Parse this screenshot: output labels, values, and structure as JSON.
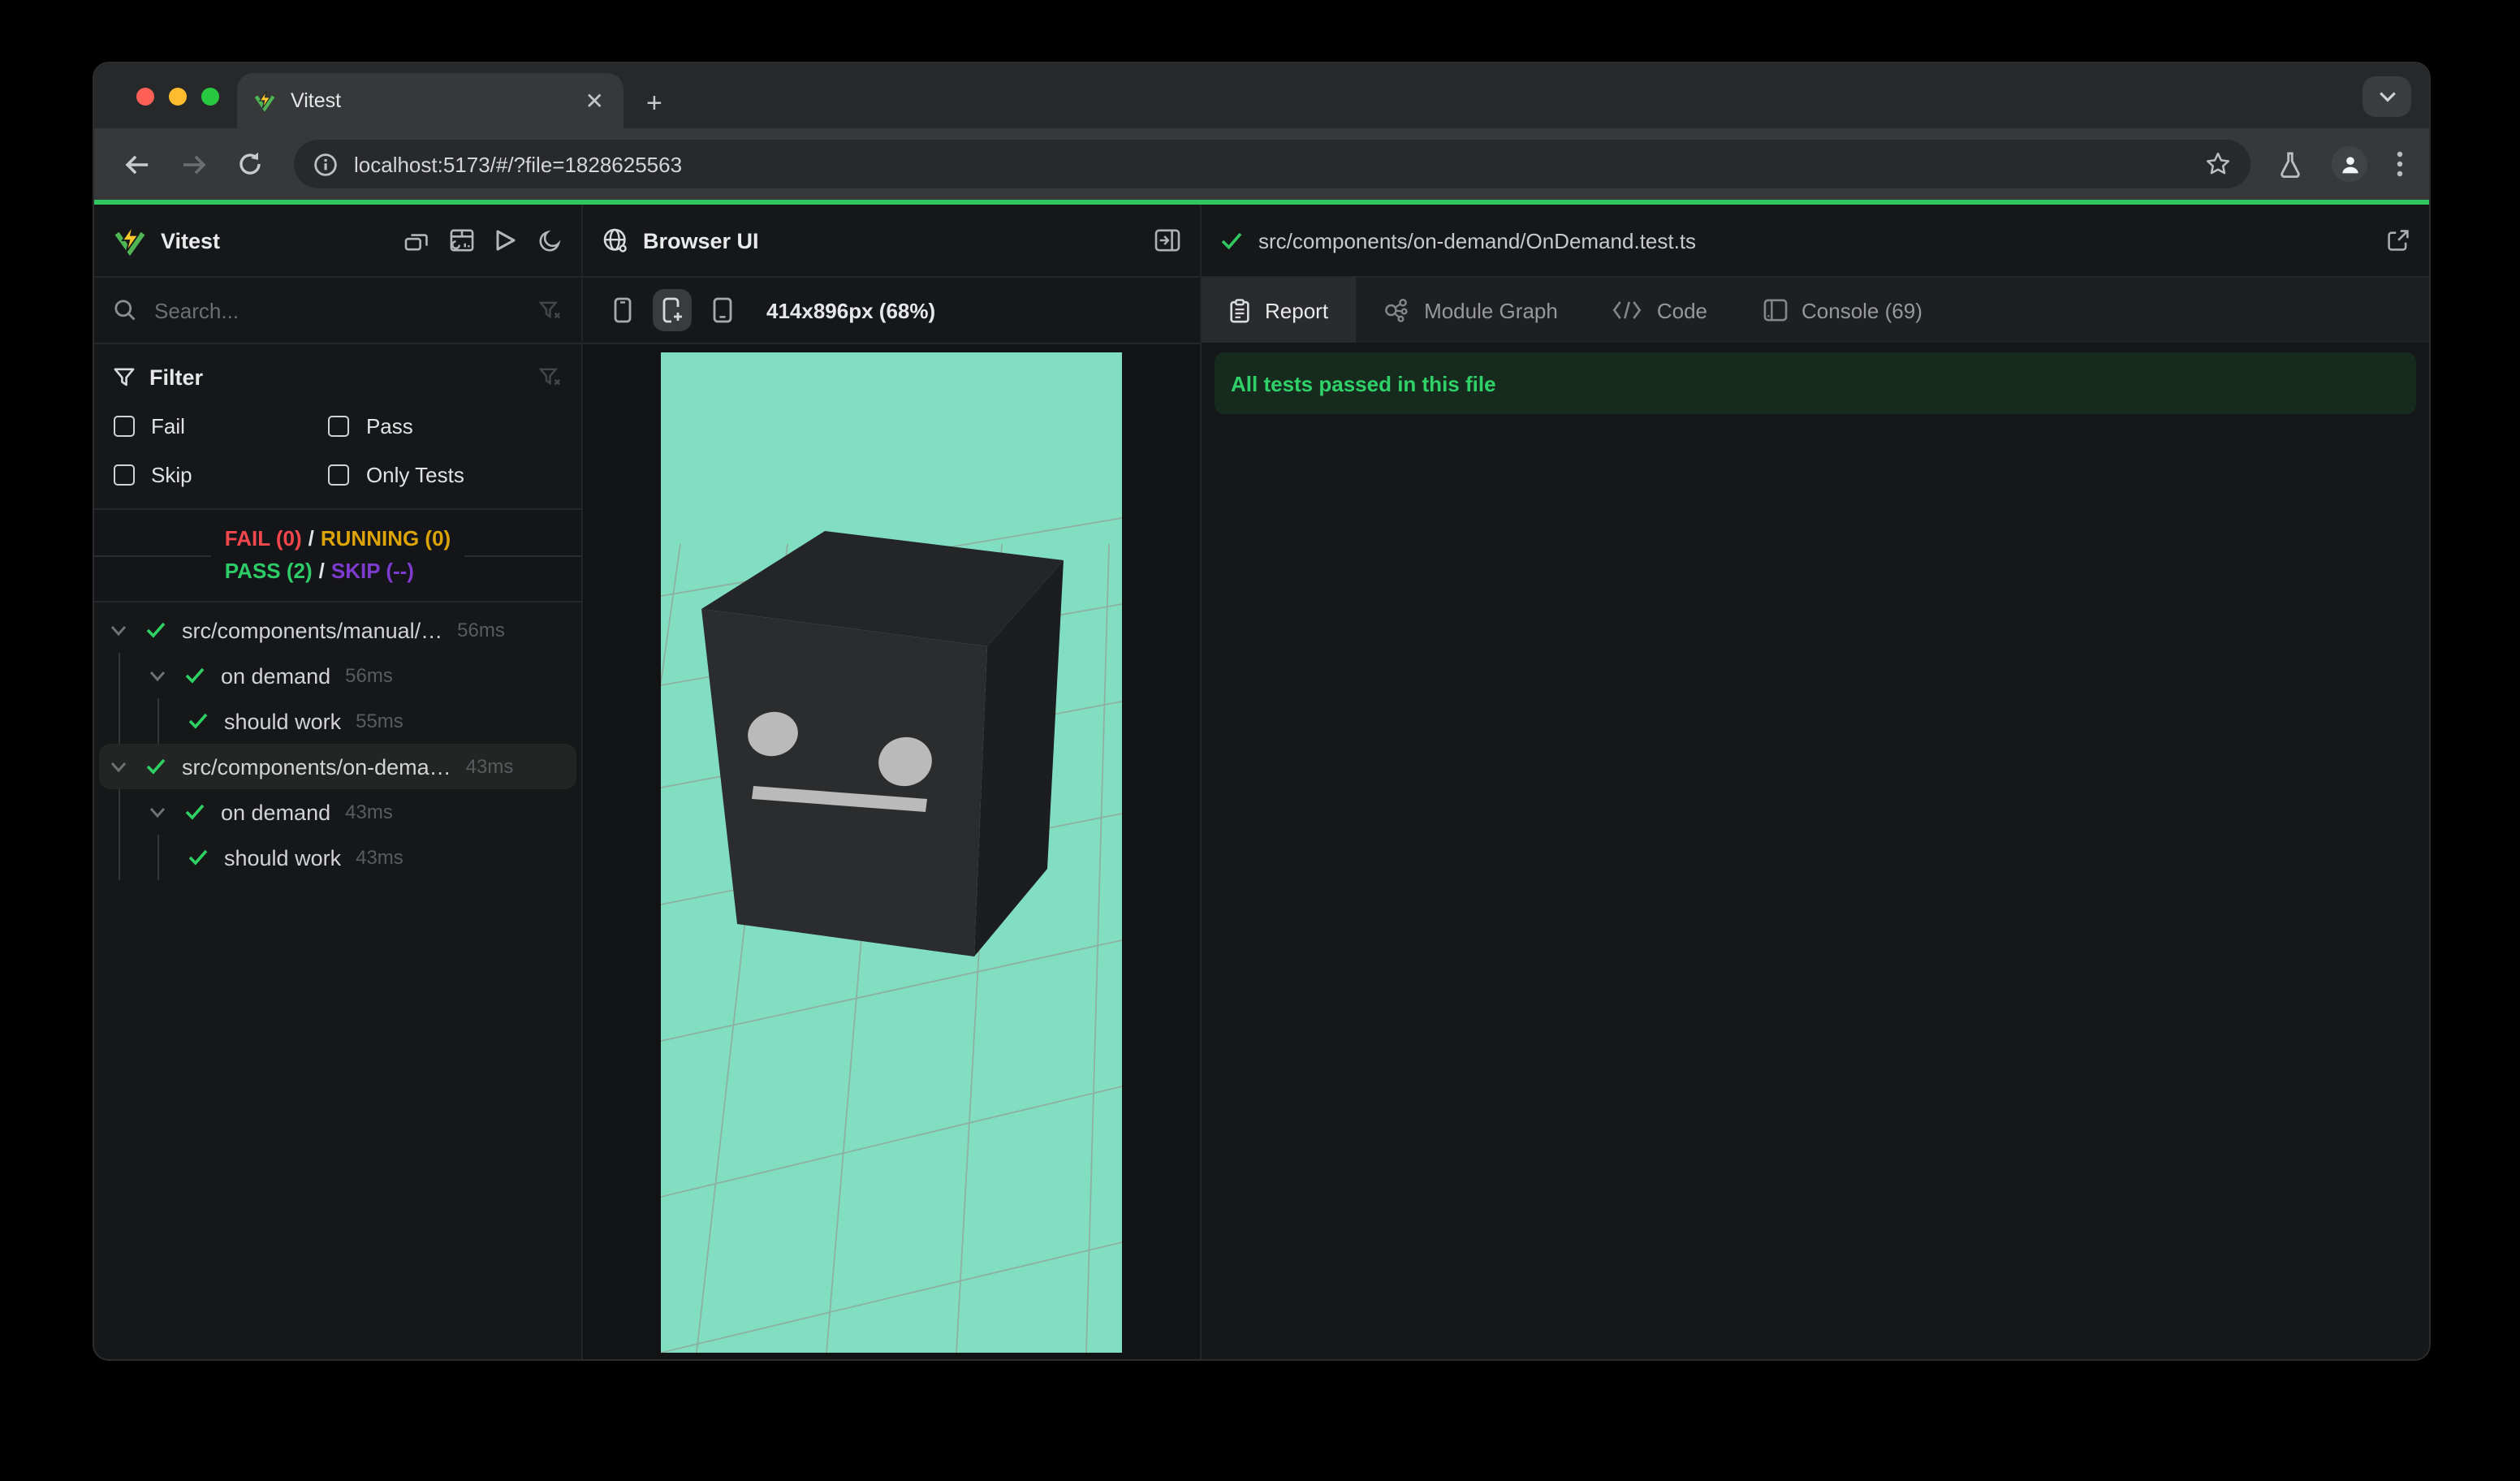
{
  "browser_chrome": {
    "tab_title": "Vitest",
    "url": "localhost:5173/#/?file=1828625563"
  },
  "sidebar": {
    "app_name": "Vitest",
    "search_placeholder": "Search...",
    "filter_title": "Filter",
    "checkboxes": [
      {
        "label": "Fail"
      },
      {
        "label": "Pass"
      },
      {
        "label": "Skip"
      },
      {
        "label": "Only Tests"
      }
    ],
    "stats": {
      "fail": "FAIL (0)",
      "running": "RUNNING (0)",
      "pass": "PASS (2)",
      "skip": "SKIP (--)",
      "separator": "/"
    },
    "tree": [
      {
        "label": "src/components/manual/…",
        "duration": "56ms"
      },
      {
        "label": "on demand",
        "duration": "56ms"
      },
      {
        "label": "should work",
        "duration": "55ms"
      },
      {
        "label": "src/components/on-dema…",
        "duration": "43ms"
      },
      {
        "label": "on demand",
        "duration": "43ms"
      },
      {
        "label": "should work",
        "duration": "43ms"
      }
    ]
  },
  "browser_panel": {
    "title": "Browser UI",
    "viewport_info": "414x896px (68%)"
  },
  "report_panel": {
    "file_path": "src/components/on-demand/OnDemand.test.ts",
    "tabs": [
      "Report",
      "Module Graph",
      "Code",
      "Console (69)"
    ],
    "banner": "All tests passed in this file"
  },
  "colors": {
    "accent_green": "#30c85e",
    "viewport_teal": "#82dec1",
    "fail_red": "#f2484d",
    "running_amber": "#dca407",
    "pass_green": "#2ecc66",
    "skip_purple": "#7d3bd0",
    "traffic_red": "#ff5f57",
    "traffic_yellow": "#febc2e",
    "traffic_green": "#28c840"
  }
}
